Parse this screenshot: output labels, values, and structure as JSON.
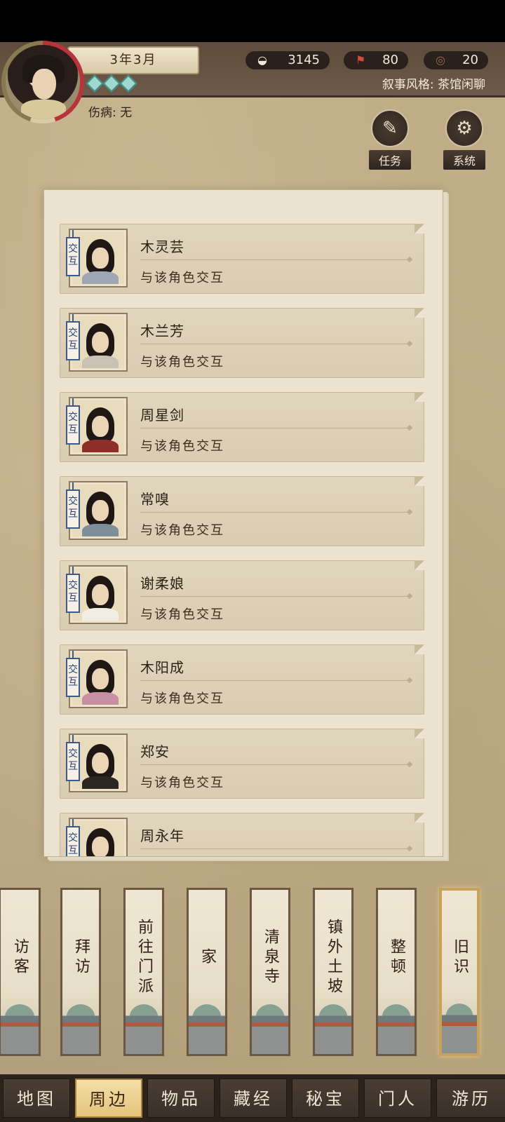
{
  "header": {
    "date": "3年3月",
    "injury_label": "伤病:",
    "injury_value": "无",
    "narration_label": "叙事风格:",
    "narration_value": "茶馆闲聊"
  },
  "resources": [
    {
      "icon": "silver-ingot-icon",
      "glyph": "◒",
      "value": "3145"
    },
    {
      "icon": "banner-flag-icon",
      "glyph": "⚑",
      "value": "80"
    },
    {
      "icon": "coin-token-icon",
      "glyph": "◎",
      "value": "20"
    }
  ],
  "buttons": {
    "tasks": "任务",
    "system": "系统"
  },
  "characters": [
    {
      "tag": "交互",
      "name": "木灵芸",
      "action": "与该角色交互",
      "cloth": "#9ea7b3"
    },
    {
      "tag": "交互",
      "name": "木兰芳",
      "action": "与该角色交互",
      "cloth": "#c9c2b4"
    },
    {
      "tag": "交互",
      "name": "周星剑",
      "action": "与该角色交互",
      "cloth": "#8e2f2a"
    },
    {
      "tag": "交互",
      "name": "常嗅",
      "action": "与该角色交互",
      "cloth": "#7e8f9a"
    },
    {
      "tag": "交互",
      "name": "谢柔娘",
      "action": "与该角色交互",
      "cloth": "#f2ede3"
    },
    {
      "tag": "交互",
      "name": "木阳成",
      "action": "与该角色交互",
      "cloth": "#c88fa3"
    },
    {
      "tag": "交互",
      "name": "郑安",
      "action": "与该角色交互",
      "cloth": "#2c2622"
    },
    {
      "tag": "交互",
      "name": "周永年",
      "action": "",
      "cloth": "#3f4f7a"
    }
  ],
  "locations": [
    "访客",
    "拜访",
    "前往门派",
    "家",
    "清泉寺",
    "镇外土坡",
    "整顿",
    "旧识"
  ],
  "selected_location": "旧识",
  "tabs": [
    "地图",
    "周边",
    "物品",
    "藏经",
    "秘宝",
    "门人",
    "游历"
  ],
  "selected_tab": "周边"
}
